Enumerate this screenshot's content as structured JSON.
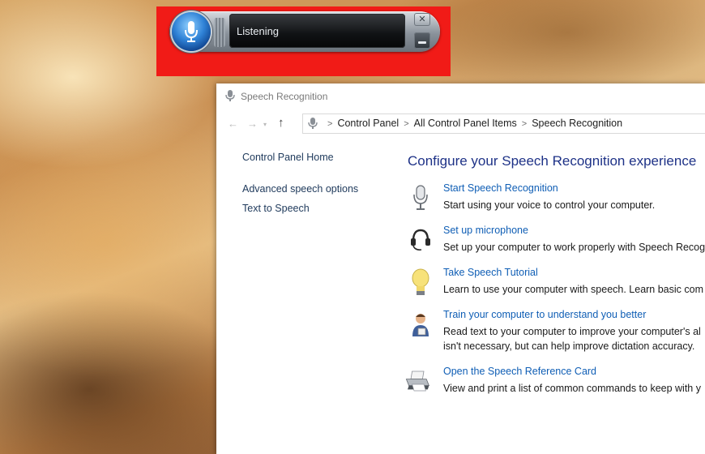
{
  "speech_bar": {
    "status": "Listening",
    "close_glyph": "✕"
  },
  "window": {
    "title": "Speech Recognition"
  },
  "address": {
    "crumbs": [
      "Control Panel",
      "All Control Panel Items",
      "Speech Recognition"
    ]
  },
  "sidebar": {
    "home": "Control Panel Home",
    "items": [
      "Advanced speech options",
      "Text to Speech"
    ]
  },
  "main": {
    "title": "Configure your Speech Recognition experience",
    "tasks": [
      {
        "icon": "microphone-icon",
        "link": "Start Speech Recognition",
        "desc": [
          "Start using your voice to control your computer."
        ]
      },
      {
        "icon": "headset-icon",
        "link": "Set up microphone",
        "desc": [
          "Set up your computer to work properly with Speech Recog"
        ]
      },
      {
        "icon": "lightbulb-icon",
        "link": "Take Speech Tutorial",
        "desc": [
          "Learn to use your computer with speech. Learn basic com"
        ]
      },
      {
        "icon": "user-training-icon",
        "link": "Train your computer to understand you better",
        "desc": [
          "Read text to your computer to improve your computer's al",
          "isn't necessary, but can help improve dictation accuracy."
        ]
      },
      {
        "icon": "printer-icon",
        "link": "Open the Speech Reference Card",
        "desc": [
          "View and print a list of common commands to keep with y"
        ]
      }
    ]
  },
  "colors": {
    "highlight": "#f11b17",
    "link": "#0f5eb5",
    "heading": "#1e3287"
  }
}
